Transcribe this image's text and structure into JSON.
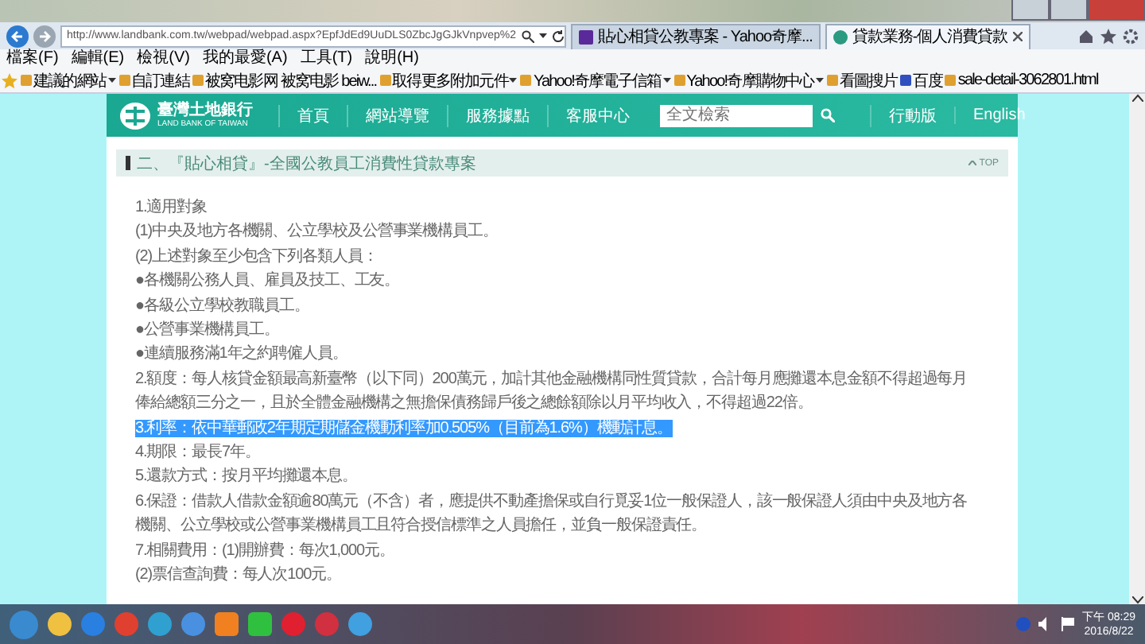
{
  "browser": {
    "address": "http://www.landbank.com.tw/webpad/webpad.aspx?EpfJdEd9UuDLS0ZbcJgGJkVnpvep%2",
    "tabs": [
      {
        "title": "貼心相貸公教專案 - Yahoo奇摩...",
        "selected": false
      },
      {
        "title": "貸款業務-個人消費貸款",
        "selected": true
      }
    ],
    "menu": [
      "檔案(F)",
      "編輯(E)",
      "檢視(V)",
      "我的最愛(A)",
      "工具(T)",
      "說明(H)"
    ],
    "favorites": [
      {
        "label": "建議的網站",
        "dropdown": true
      },
      {
        "label": "自訂連結",
        "dropdown": false
      },
      {
        "label": "被窝电影网 被窝电影 beiw...",
        "dropdown": false
      },
      {
        "label": "取得更多附加元件",
        "dropdown": true
      },
      {
        "label": "Yahoo!奇摩電子信箱",
        "dropdown": true
      },
      {
        "label": "Yahoo!奇摩購物中心",
        "dropdown": true
      },
      {
        "label": "看圖搜片",
        "dropdown": false
      },
      {
        "label": "百度",
        "dropdown": false
      },
      {
        "label": "sale-detail-3062801.html",
        "dropdown": false
      }
    ]
  },
  "site": {
    "logo_name": "臺灣土地銀行",
    "logo_subtitle": "LAND BANK OF TAIWAN",
    "nav": [
      "首頁",
      "網站導覽",
      "服務據點",
      "客服中心"
    ],
    "search": {
      "placeholder": "全文檢索"
    },
    "mobile": "行動版",
    "english": "English"
  },
  "section": {
    "title": "二、『貼心相貸』-全國公教員工消費性貸款專案",
    "top": "TOP",
    "lines": [
      {
        "text": "1.適用對象",
        "highlighted": false
      },
      {
        "text": "(1)中央及地方各機關、公立學校及公營事業機構員工。",
        "highlighted": false
      },
      {
        "text": "(2)上述對象至少包含下列各類人員：",
        "highlighted": false
      },
      {
        "text": "●各機關公務人員、雇員及技工、工友。",
        "highlighted": false
      },
      {
        "text": "●各級公立學校教職員工。",
        "highlighted": false
      },
      {
        "text": "●公營事業機構員工。",
        "highlighted": false
      },
      {
        "text": "●連續服務滿1年之約聘僱人員。",
        "highlighted": false
      },
      {
        "text": "2.額度：每人核貸金額最高新臺幣（以下同）200萬元，加計其他金融機構同性質貸款，合計每月應攤還本息金額不得超過每月俸給總額三分之一，且於全體金融機構之無擔保債務歸戶後之總餘額除以月平均收入，不得超過22倍。",
        "highlighted": false
      },
      {
        "text": "3.利率：依中華郵政2年期定期儲金機動利率加0.505%（目前為1.6%）機動計息。",
        "highlighted": true
      },
      {
        "text": "4.期限：最長7年。",
        "highlighted": false
      },
      {
        "text": "5.還款方式：按月平均攤還本息。",
        "highlighted": false
      },
      {
        "text": "6.保證：借款人借款金額逾80萬元（不含）者，應提供不動產擔保或自行覓妥1位一般保證人，該一般保證人須由中央及地方各機關、公立學校或公營事業機構員工且符合授信標準之人員擔任，並負一般保證責任。",
        "highlighted": false
      },
      {
        "text": "7.相關費用：(1)開辦費：每次1,000元。",
        "highlighted": false
      },
      {
        "text": "(2)票信查詢費：每人次100元。",
        "highlighted": false
      }
    ]
  },
  "taskbar": {
    "time": "下午 08:29",
    "date": "2016/8/22"
  }
}
